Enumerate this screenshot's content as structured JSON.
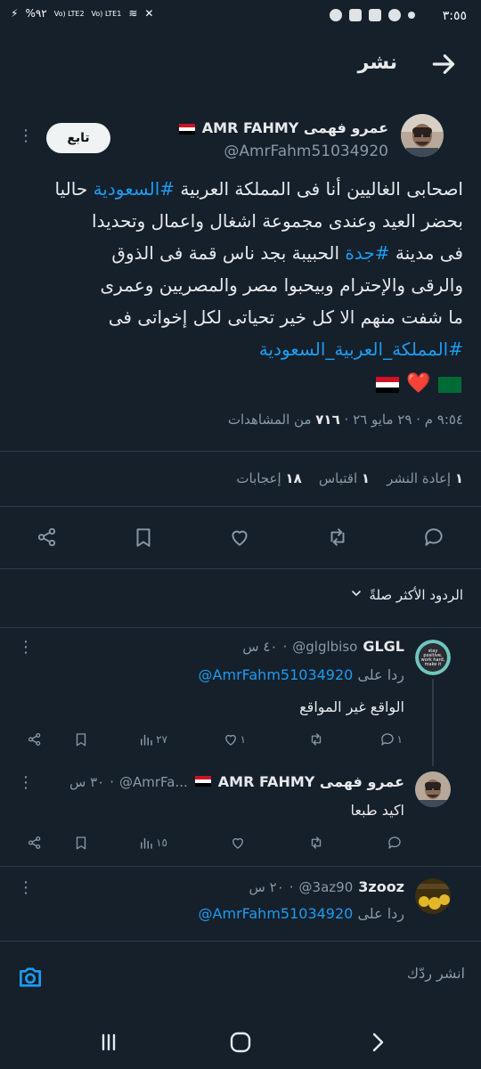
{
  "status_bar": {
    "time": "٣:٥٥",
    "battery": "%٩٢",
    "lte1": "Vo) LTE1",
    "lte2": "Vo) LTE2"
  },
  "header": {
    "title": "نشر"
  },
  "tweet": {
    "display_name": "عمرو فهمى AMR FAHMY",
    "handle": "@AmrFahm51034920",
    "follow_label": "تابع",
    "text_lines": [
      "اصحابى الغاليين أنا فى المملكة العربية #السعودية حاليا",
      "بحضر العيد وعندى مجموعة اشغال واعمال وتحديدا",
      "فى مدينة #جدة الحبيبة بجد ناس قمة فى الذوق",
      "والرقى والإحترام وبيحبوا مصر والمصريين وعمرى",
      "ما شفت منهم الا كل خير تحياتى لكل إخواتى فى",
      "#المملكة_العربية_السعودية"
    ],
    "hashtags": {
      "saudi": "#السعودية",
      "jeddah": "#جدة",
      "kingdom": "#المملكة_العربية_السعودية"
    },
    "line1_a": "اصحابى الغاليين أنا فى المملكة العربية ",
    "line1_b": " حاليا",
    "line2": "بحضر العيد وعندى مجموعة اشغال واعمال وتحديدا",
    "line3_a": "فى مدينة ",
    "line3_b": " الحبيبة بجد ناس قمة فى الذوق",
    "line4": "والرقى والإحترام وبيحبوا مصر والمصريين وعمرى",
    "line5": "ما شفت منهم الا كل خير تحياتى لكل إخواتى فى",
    "emoji_heart": "❤️",
    "timestamp": "٩:٥٤ م · ٢٩ مايو ٢٦",
    "views_count": "٧١٦",
    "views_label": "من المشاهدات",
    "stats": {
      "retweets_count": "١",
      "retweets_label": "إعادة النشر",
      "quotes_count": "١",
      "quotes_label": "اقتباس",
      "likes_count": "١٨",
      "likes_label": "إعجابات"
    }
  },
  "sort": {
    "label": "الردود الأكثر صلةً"
  },
  "replies": [
    {
      "name": "GLGL",
      "handle": "@glglbiso",
      "time": "٤٠ س",
      "replying_to_label": "ردا على",
      "replying_to": "@AmrFahm51034920",
      "text": "الواقع غير المواقع",
      "avatar_text": "stay positive, work hard, and make it happen",
      "replies": "١",
      "likes": "١",
      "views": "٢٧"
    },
    {
      "name": "عمرو فهمى AMR FAHMY",
      "handle": "@AmrFa...",
      "time": "٣٠ س",
      "text": "اكيد طبعا",
      "views": "١٥"
    },
    {
      "name": "3zooz",
      "handle": "@3az90",
      "time": "٢٠ س",
      "replying_to_label": "ردا على",
      "replying_to": "@AmrFahm51034920"
    }
  ],
  "compose": {
    "placeholder": "انشر ردّك"
  },
  "colors": {
    "background": "#15202b",
    "accent": "#1d9bf0",
    "muted": "#8b98a5",
    "text": "#e7e9ea"
  }
}
